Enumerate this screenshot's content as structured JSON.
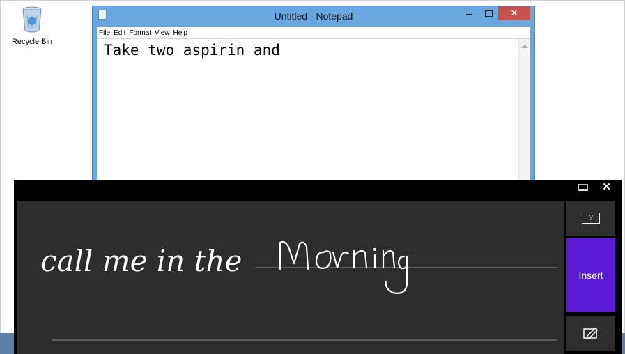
{
  "desktop": {
    "recycle_bin_label": "Recycle Bin"
  },
  "notepad": {
    "title": "Untitled - Notepad",
    "menu": [
      "File",
      "Edit",
      "Format",
      "View",
      "Help"
    ],
    "content": "Take two aspirin and",
    "colors": {
      "frame": "#6aa6df",
      "close": "#c7504a"
    }
  },
  "handwriting_panel": {
    "recognized_typed_text": "call me in the",
    "handwritten_word": "Morning",
    "help_label": "?",
    "insert_label": "Insert",
    "colors": {
      "panel": "#000000",
      "canvas": "#2d2d2d",
      "insert": "#5b1bd6"
    }
  },
  "icons": {
    "close": "close-icon",
    "minimize": "minimize-icon",
    "maximize": "maximize-icon",
    "dock": "dock-icon",
    "help": "help-icon",
    "pen": "pen-icon"
  }
}
